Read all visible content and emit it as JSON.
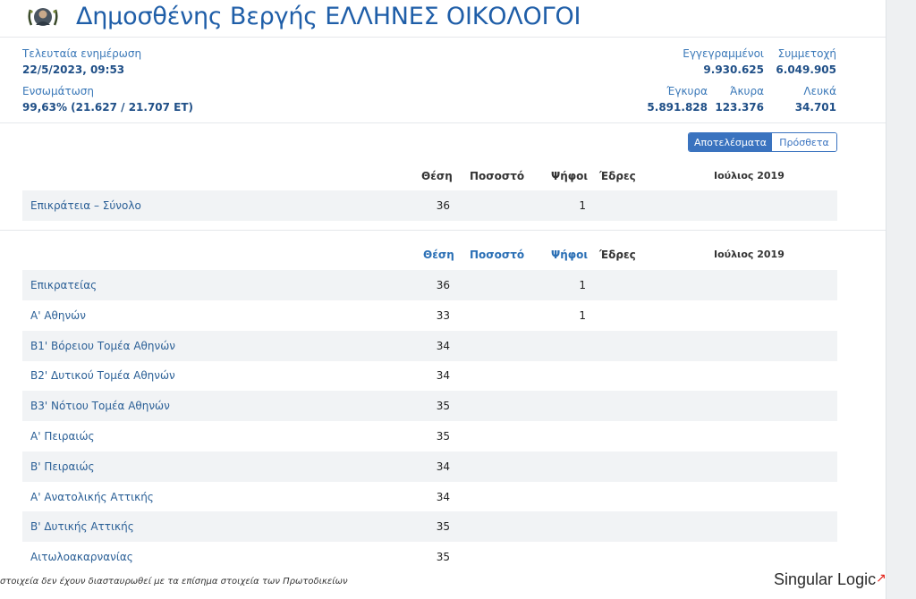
{
  "header": {
    "title": "Δημοσθένης Βεργής ΕΛΛΗΝΕΣ ΟΙΚΟΛΟΓΟΙ",
    "logo_icon": "party-logo-icon"
  },
  "info": {
    "last_update_label": "Τελευταία ενημέρωση",
    "last_update_value": "22/5/2023, 09:53",
    "integration_label": "Ενσωμάτωση",
    "integration_value": "99,63% (21.627 / 21.707 ΕΤ)",
    "registered_label": "Εγγεγραμμένοι",
    "registered_value": "9.930.625",
    "turnout_label": "Συμμετοχή",
    "turnout_value": "6.049.905",
    "valid_label": "Έγκυρα",
    "valid_value": "5.891.828",
    "invalid_label": "Άκυρα",
    "invalid_value": "123.376",
    "blank_label": "Λευκά",
    "blank_value": "34.701"
  },
  "toggle": {
    "results_label": "Αποτελέσματα",
    "extra_label": "Πρόσθετα"
  },
  "table1": {
    "headers": {
      "position": "Θέση",
      "percent": "Ποσοστό",
      "votes": "Ψήφοι",
      "seats": "Έδρες",
      "previous": "Ιούλιος 2019"
    },
    "rows": [
      {
        "name": "Επικράτεια – Σύνολο",
        "position": "36",
        "percent": "",
        "votes": "1",
        "seats": ""
      }
    ]
  },
  "table2": {
    "headers": {
      "position": "Θέση",
      "percent": "Ποσοστό",
      "votes": "Ψήφοι",
      "seats": "Έδρες",
      "previous": "Ιούλιος 2019"
    },
    "rows": [
      {
        "name": "Επικρατείας",
        "position": "36",
        "votes": "1"
      },
      {
        "name": "Α' Αθηνών",
        "position": "33",
        "votes": "1"
      },
      {
        "name": "Β1' Βόρειου Τομέα Αθηνών",
        "position": "34",
        "votes": ""
      },
      {
        "name": "Β2' Δυτικού Τομέα Αθηνών",
        "position": "34",
        "votes": ""
      },
      {
        "name": "Β3' Νότιου Τομέα Αθηνών",
        "position": "35",
        "votes": ""
      },
      {
        "name": "Α' Πειραιώς",
        "position": "35",
        "votes": ""
      },
      {
        "name": "Β' Πειραιώς",
        "position": "34",
        "votes": ""
      },
      {
        "name": "Α' Ανατολικής Αττικής",
        "position": "34",
        "votes": ""
      },
      {
        "name": "Β' Δυτικής Αττικής",
        "position": "35",
        "votes": ""
      },
      {
        "name": "Αιτωλοακαρνανίας",
        "position": "35",
        "votes": ""
      }
    ]
  },
  "footer": {
    "disclaimer": "στοιχεία δεν έχουν διασταυρωθεί με τα επίσημα στοιχεία των Πρωτοδικείων",
    "brand": "Singular Logic"
  }
}
